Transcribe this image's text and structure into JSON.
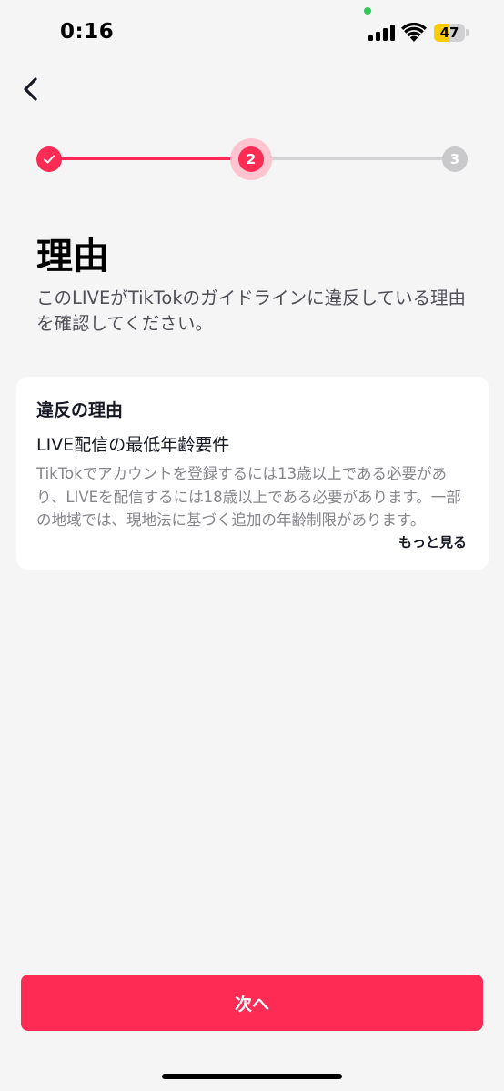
{
  "status_bar": {
    "time": "0:16",
    "battery_level": "47",
    "battery_fraction": 0.47
  },
  "stepper": {
    "steps": [
      {
        "label": "",
        "state": "done"
      },
      {
        "label": "2",
        "state": "current"
      },
      {
        "label": "3",
        "state": "upcoming"
      }
    ]
  },
  "header": {
    "title": "理由",
    "description": "このLIVEがTikTokのガイドラインに違反している理由を確認してください。"
  },
  "reason_card": {
    "heading": "違反の理由",
    "subtitle": "LIVE配信の最低年齢要件",
    "body": "TikTokでアカウントを登録するには13歳以上である必要があり、LIVEを配信するには18歳以上である必要があります。一部の地域では、現地法に基づく追加の年齢制限があります。",
    "see_more_label": "もっと見る"
  },
  "footer": {
    "next_label": "次へ"
  },
  "colors": {
    "accent": "#fe2c55",
    "accent_light": "#ffc4cf",
    "inactive": "#c9c9cc",
    "background": "#f5f5f6"
  },
  "icons": {
    "back": "chevron-left-icon",
    "check": "check-icon",
    "signal": "cellular-signal-icon",
    "wifi": "wifi-icon",
    "battery": "battery-icon"
  }
}
